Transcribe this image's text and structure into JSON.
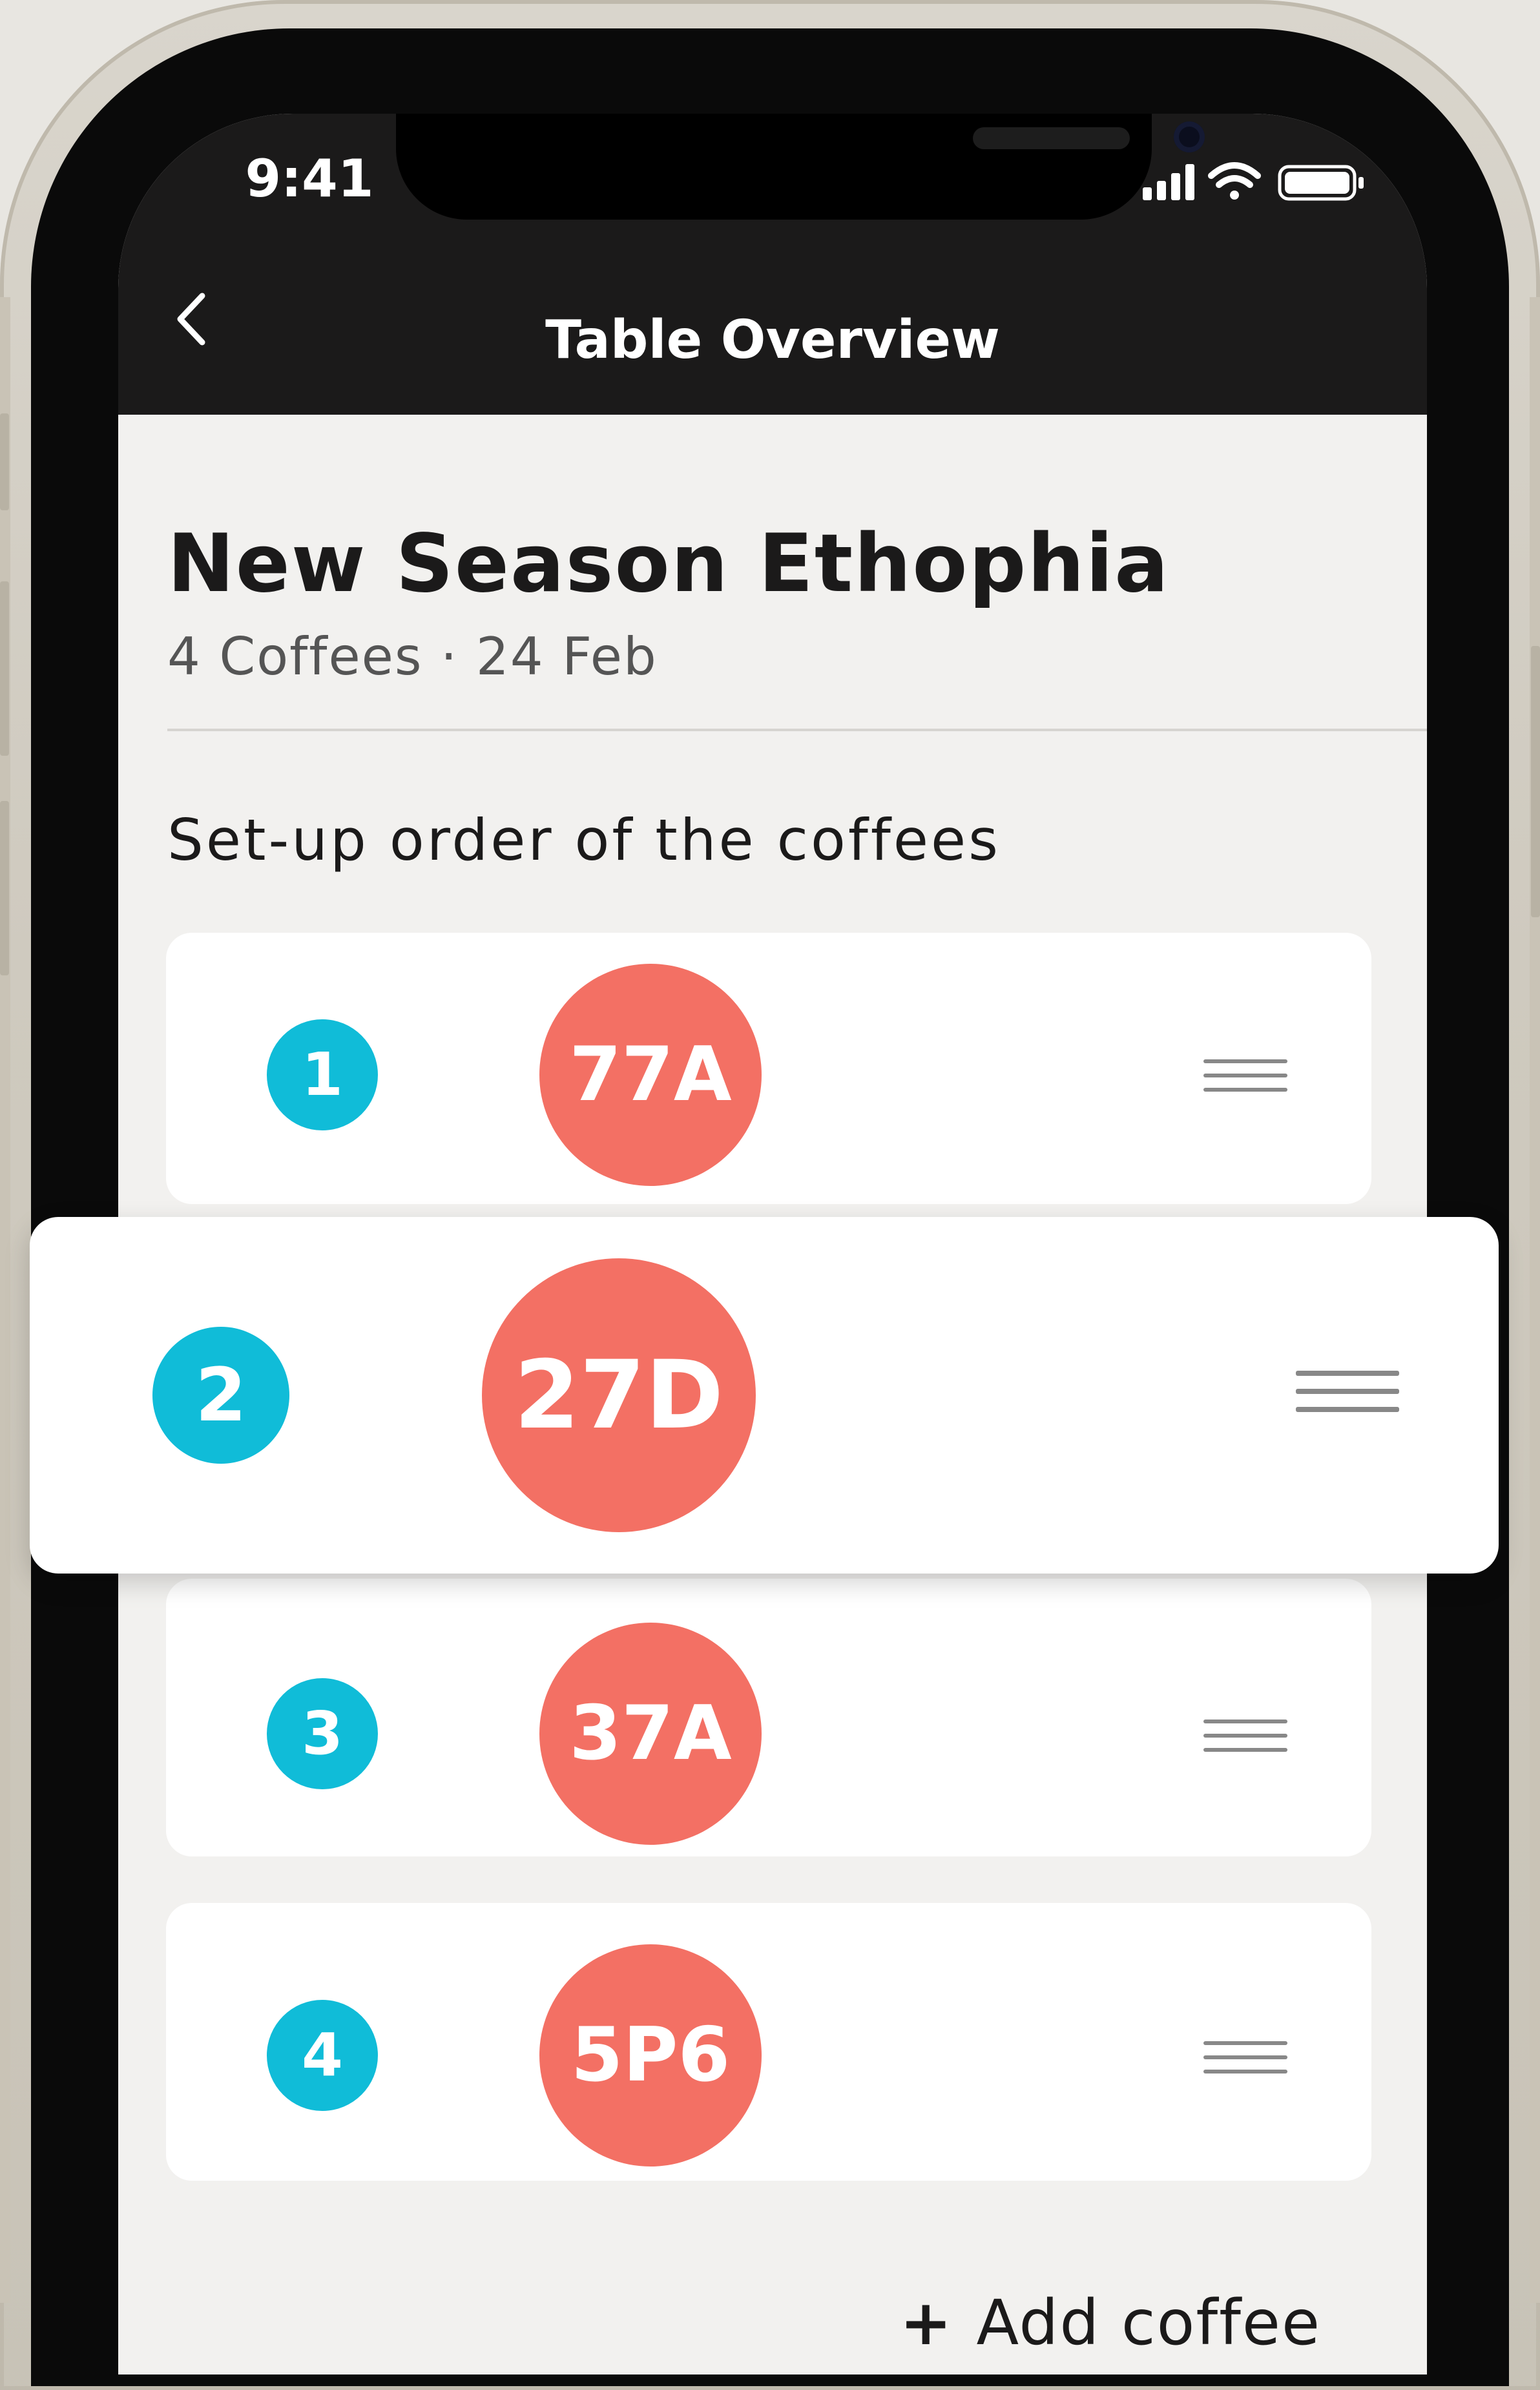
{
  "status_bar": {
    "time": "9:41"
  },
  "nav": {
    "title": "Table Overview"
  },
  "table": {
    "name": "New Season Ethophia",
    "meta": "4 Coffees · 24 Feb"
  },
  "section": {
    "label": "Set-up order of the coffees"
  },
  "coffees": [
    {
      "order": "1",
      "code": "77A"
    },
    {
      "order": "2",
      "code": "27D"
    },
    {
      "order": "3",
      "code": "37A"
    },
    {
      "order": "4",
      "code": "5P6"
    }
  ],
  "add_coffee": {
    "label": "Add coffee"
  },
  "colors": {
    "order_badge": "#10bcd8",
    "coffee_badge": "#f37064",
    "nav_background": "#1b1a1a",
    "screen_background": "#f2f1ef"
  },
  "icons": {
    "back": "chevron-left-icon",
    "drag": "drag-handle-icon",
    "add": "plus-icon",
    "signal": "cellular-signal-icon",
    "wifi": "wifi-icon",
    "battery": "battery-icon"
  }
}
